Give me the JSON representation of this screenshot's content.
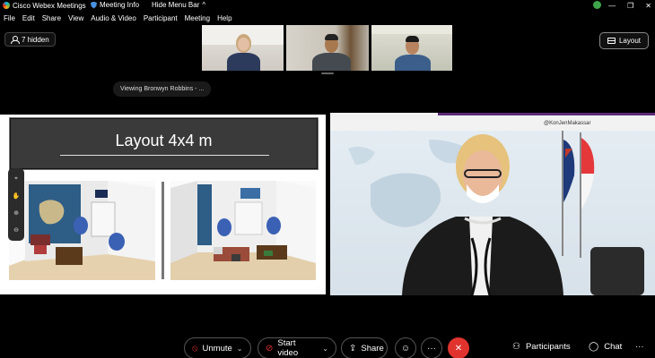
{
  "titlebar": {
    "app_title": "Cisco Webex Meetings",
    "meeting_info": "Meeting Info",
    "hide_menu": "Hide Menu Bar",
    "hide_menu_chevron": "^",
    "minimize": "—",
    "restore": "❐",
    "close": "✕"
  },
  "menu": {
    "items": [
      "File",
      "Edit",
      "Share",
      "View",
      "Audio & Video",
      "Participant",
      "Meeting",
      "Help"
    ]
  },
  "hidden_label": "7 hidden",
  "layout_label": "Layout",
  "viewing_label": "Viewing Bronwyn Robbins - ...",
  "slide": {
    "title": "Layout 4x4  m"
  },
  "speaker": {
    "banner_text": "@KonJenMakassar"
  },
  "tools": [
    "⌖",
    "✋",
    "⊕",
    "⊖"
  ],
  "toolbar": {
    "unmute": "Unmute",
    "start_video": "Start video",
    "share": "Share",
    "reaction_icon": "☺",
    "more": "···",
    "end": "✕",
    "participants": "Participants",
    "chat": "Chat",
    "overflow": "···",
    "chevron": "⌄"
  },
  "colors": {
    "end_call": "#e0332e",
    "slide_header": "#3a3a3a",
    "webex_status": "#3fa54a"
  }
}
